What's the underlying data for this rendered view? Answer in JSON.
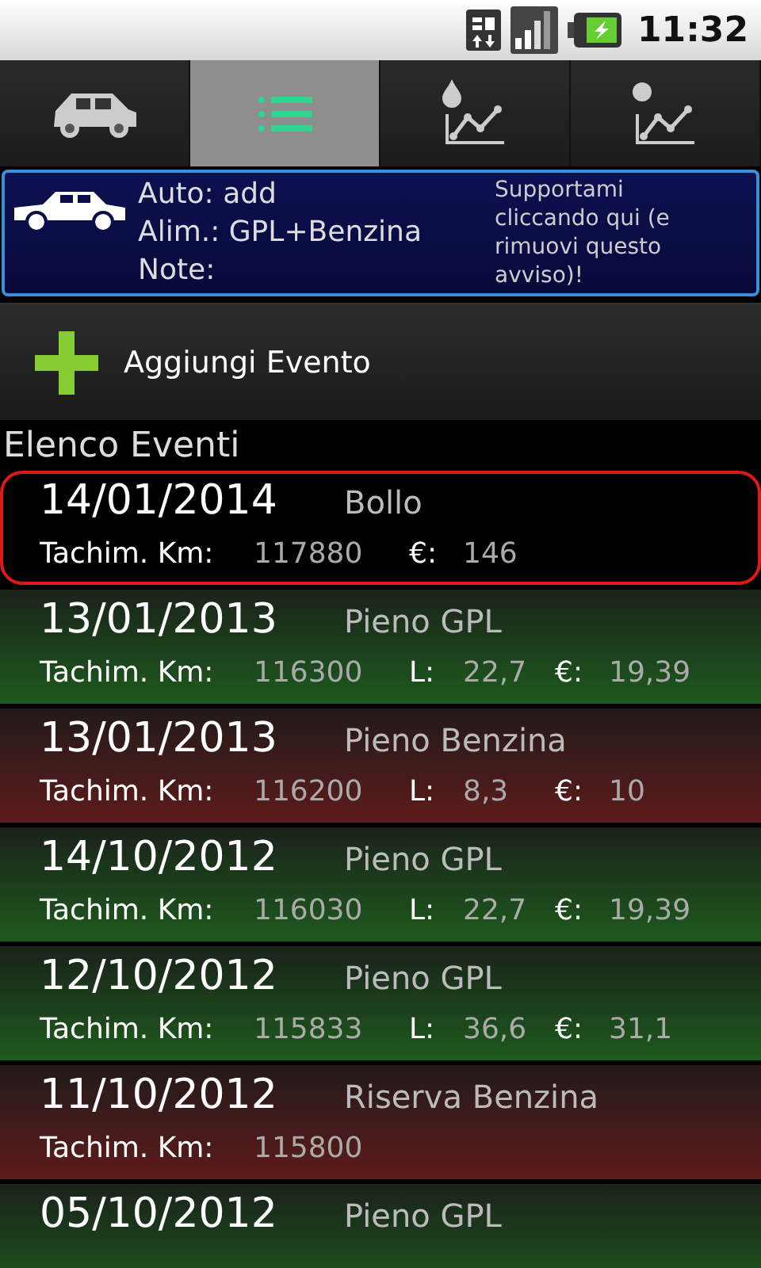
{
  "status_bar": {
    "time": "11:32"
  },
  "tabs": [
    {
      "kind": "car",
      "selected": false
    },
    {
      "kind": "list",
      "selected": true
    },
    {
      "kind": "fuel",
      "selected": false
    },
    {
      "kind": "cost",
      "selected": false
    }
  ],
  "car_info": {
    "lines": [
      "Auto: add",
      "Alim.: GPL+Benzina",
      "Note:"
    ],
    "promo": "Supportami cliccando qui (e rimuovi questo avviso)!"
  },
  "add_button": {
    "label": "Aggiungi Evento"
  },
  "section_title": "Elenco Eventi",
  "events": [
    {
      "kind": "other",
      "selected": true,
      "date": "14/01/2014",
      "type": "Bollo",
      "details": [
        {
          "label": "Tachim. Km:",
          "value": "117880"
        },
        {
          "label": "€:",
          "value": "146"
        }
      ]
    },
    {
      "kind": "gpl",
      "selected": false,
      "date": "13/01/2013",
      "type": "Pieno GPL",
      "details": [
        {
          "label": "Tachim. Km:",
          "value": "116300"
        },
        {
          "label": "L:",
          "value": "22,7"
        },
        {
          "label": "€:",
          "value": "19,39"
        }
      ]
    },
    {
      "kind": "benzina",
      "selected": false,
      "date": "13/01/2013",
      "type": "Pieno Benzina",
      "details": [
        {
          "label": "Tachim. Km:",
          "value": "116200"
        },
        {
          "label": "L:",
          "value": "8,3"
        },
        {
          "label": "€:",
          "value": "10"
        }
      ]
    },
    {
      "kind": "gpl",
      "selected": false,
      "date": "14/10/2012",
      "type": "Pieno GPL",
      "details": [
        {
          "label": "Tachim. Km:",
          "value": "116030"
        },
        {
          "label": "L:",
          "value": "22,7"
        },
        {
          "label": "€:",
          "value": "19,39"
        }
      ]
    },
    {
      "kind": "gpl",
      "selected": false,
      "date": "12/10/2012",
      "type": "Pieno GPL",
      "details": [
        {
          "label": "Tachim. Km:",
          "value": "115833"
        },
        {
          "label": "L:",
          "value": "36,6"
        },
        {
          "label": "€:",
          "value": "31,1"
        }
      ]
    },
    {
      "kind": "benzina",
      "selected": false,
      "date": "11/10/2012",
      "type": "Riserva Benzina",
      "details": [
        {
          "label": "Tachim. Km:",
          "value": "115800"
        }
      ]
    },
    {
      "kind": "gpl",
      "selected": false,
      "date": "05/10/2012",
      "type": "Pieno GPL"
    }
  ]
}
